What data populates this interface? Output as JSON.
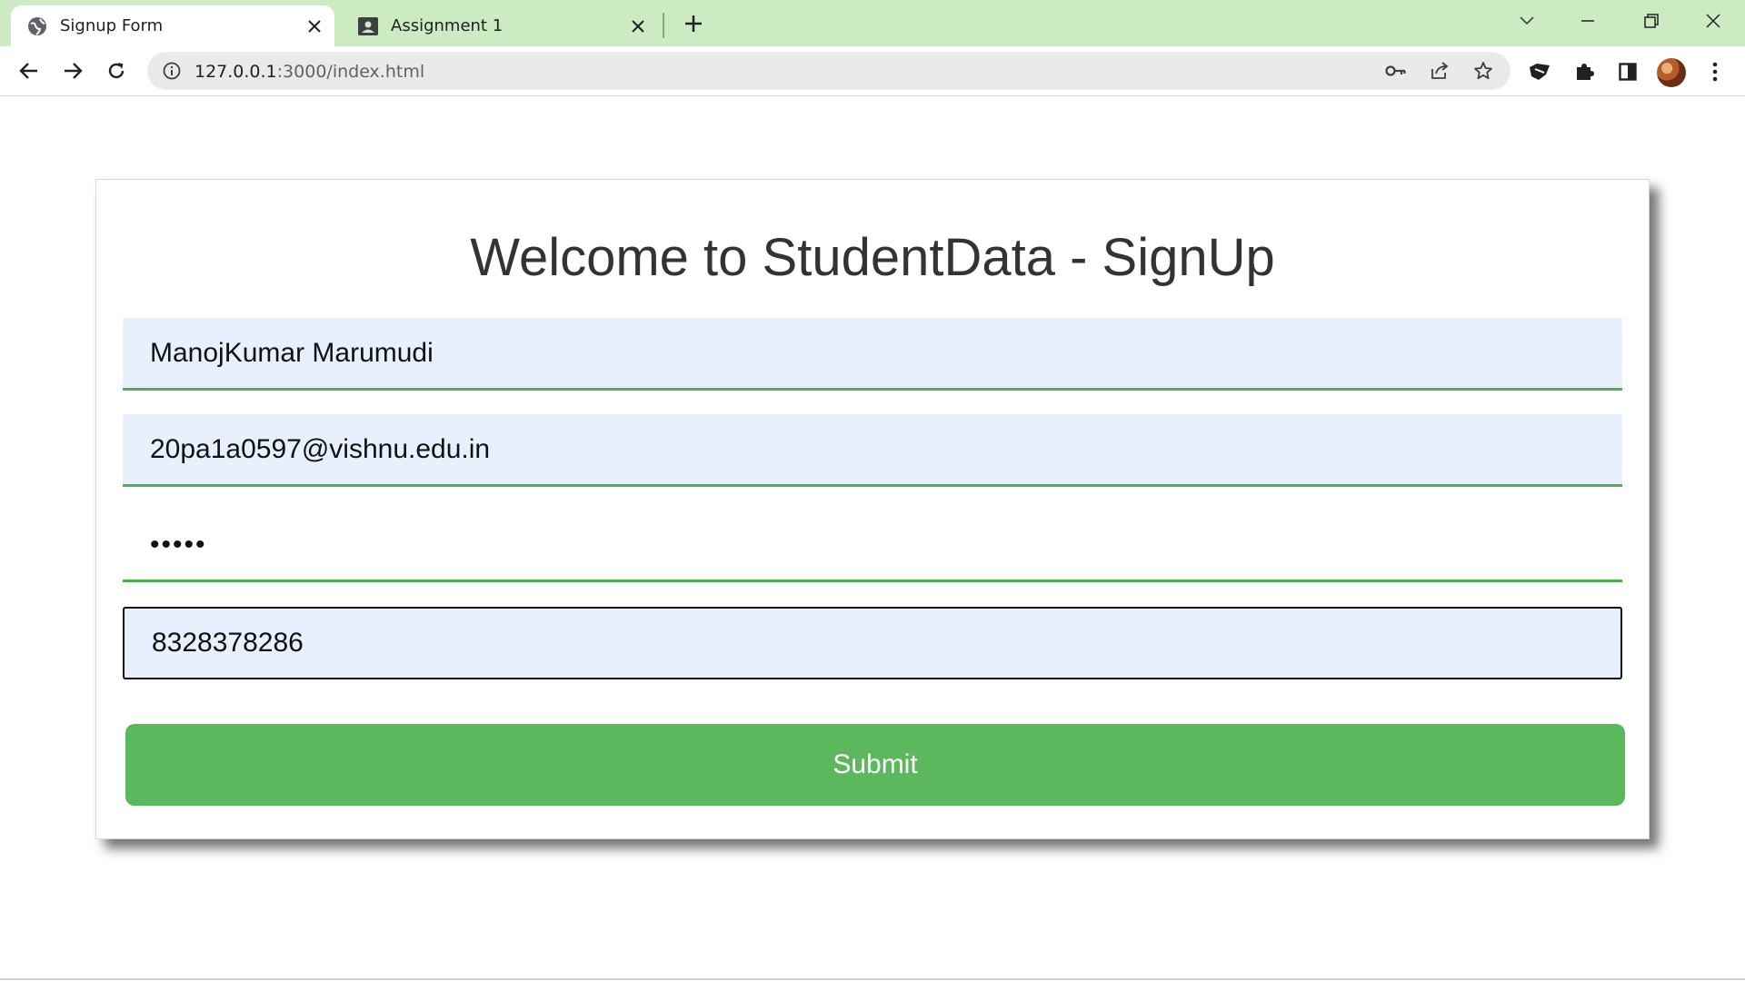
{
  "browser": {
    "tabs": [
      {
        "title": "Signup Form",
        "icon": "globe-icon",
        "active": true
      },
      {
        "title": "Assignment 1",
        "icon": "contact-card-icon",
        "active": false
      }
    ],
    "url": {
      "host": "127.0.0.1",
      "path": ":3000/index.html"
    },
    "colors": {
      "tabstrip": "#cdebc2",
      "omnibox": "#e8ebe8"
    }
  },
  "page": {
    "heading": "Welcome to StudentData - SignUp",
    "fields": {
      "name": "ManojKumar Marumudi",
      "email": "20pa1a0597@vishnu.edu.in",
      "password": "•••••",
      "phone": "8328378286"
    },
    "submit_label": "Submit",
    "colors": {
      "accent": "#4caf50",
      "button": "#5cb85c",
      "autofill": "#e8f0fe"
    }
  }
}
